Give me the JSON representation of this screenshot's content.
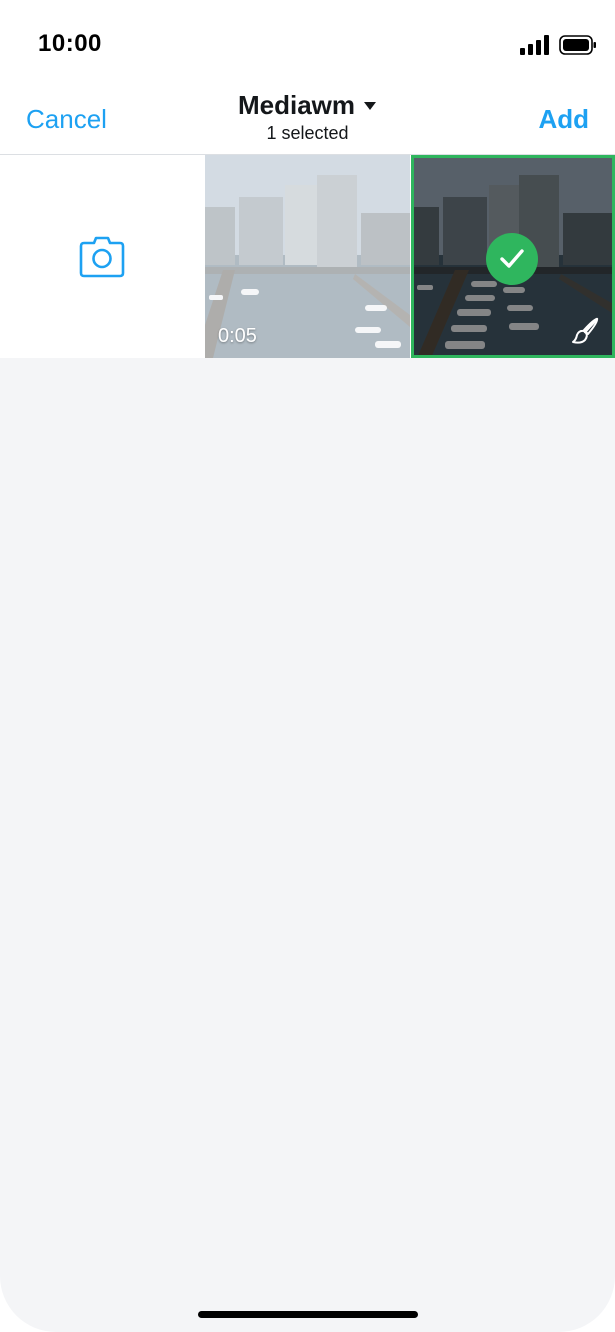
{
  "status_bar": {
    "time": "10:00"
  },
  "nav": {
    "cancel_label": "Cancel",
    "album_title": "Mediawm",
    "selection_count": "1 selected",
    "add_label": "Add"
  },
  "grid": {
    "items": [
      {
        "kind": "camera",
        "icon": "camera-icon"
      },
      {
        "kind": "video",
        "duration": "0:05",
        "selected": false
      },
      {
        "kind": "photo",
        "selected": true,
        "badge_icon": "checkmark-icon",
        "action_icon": "paintbrush-icon"
      }
    ]
  },
  "colors": {
    "accent": "#1da1f2",
    "selected": "#2fb65e",
    "background": "#f4f5f7"
  }
}
